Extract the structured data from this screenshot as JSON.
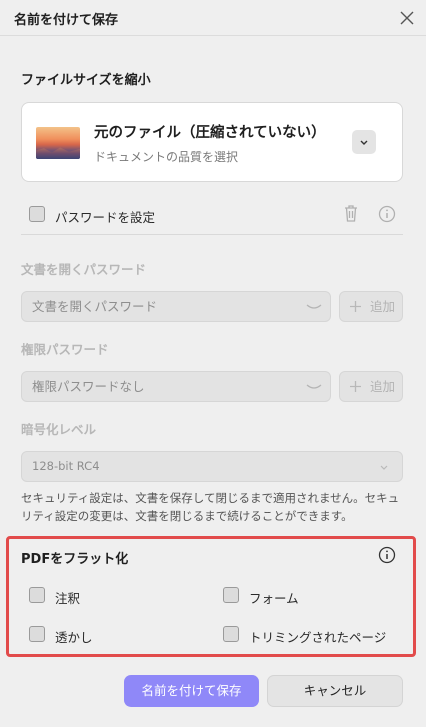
{
  "dialog": {
    "title": "名前を付けて保存"
  },
  "compress": {
    "heading": "ファイルサイズを縮小",
    "file_name": "元のファイル（圧縮されていない）",
    "file_sub": "ドキュメントの品質を選択"
  },
  "password": {
    "checkbox_label": "パスワードを設定",
    "open_label": "文書を開くパスワード",
    "open_placeholder": "文書を開くパスワード",
    "add_label": "追加",
    "perm_label": "権限パスワード",
    "perm_placeholder": "権限パスワードなし",
    "enc_label": "暗号化レベル",
    "enc_value": "128-bit RC4",
    "note": "セキュリティ設定は、文書を保存して閉じるまで適用されません。セキュリティ設定の変更は、文書を閉じるまで続けることができます。"
  },
  "flatten": {
    "heading": "PDFをフラット化",
    "options": [
      "注釈",
      "フォーム",
      "透かし",
      "トリミングされたページ"
    ]
  },
  "buttons": {
    "save": "名前を付けて保存",
    "cancel": "キャンセル"
  },
  "colors": {
    "accent": "#8f88f8",
    "highlight_border": "#e24b4b"
  }
}
